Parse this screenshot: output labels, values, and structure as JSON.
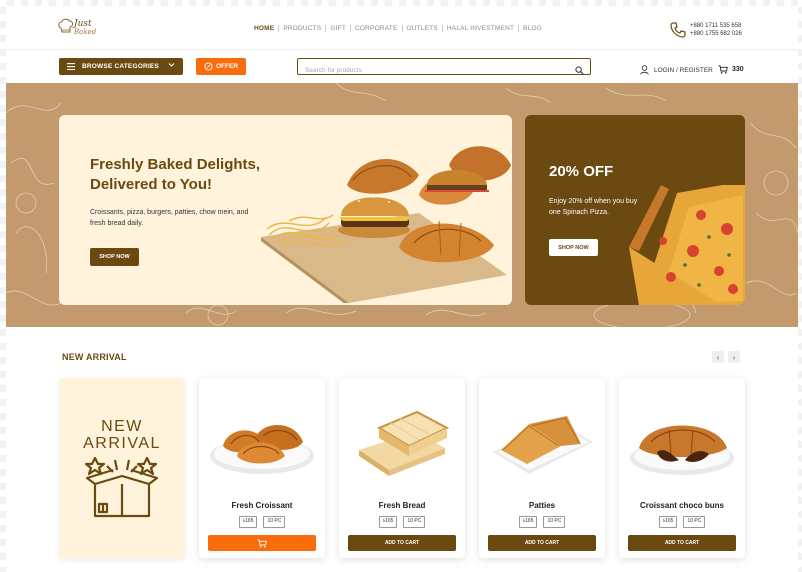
{
  "brand": {
    "logo_text_line1": "Just",
    "logo_text_line2": "Baked"
  },
  "nav": [
    {
      "label": "HOME",
      "active": true
    },
    {
      "label": "PRODUCTS"
    },
    {
      "label": "GIFT"
    },
    {
      "label": "CORPORATE"
    },
    {
      "label": "OUTLETS"
    },
    {
      "label": "HALAL INVESTMENT"
    },
    {
      "label": "BLOG"
    }
  ],
  "contact": {
    "phone1": "+880 1711 535 658",
    "phone2": "+880 1755 682 026"
  },
  "toolbar": {
    "browse_label": "BROWSE CATEGORIES",
    "offer_label": "OFFER",
    "search_placeholder": "Search for products",
    "login_label": "LOGIN / REGISTER",
    "cart_count": "330"
  },
  "hero": {
    "title": "Freshly Baked Delights, Delivered to You!",
    "description": "Croissants, pizza, burgers, patties, chow mein, and fresh bread daily.",
    "button_label": "SHOP NOW"
  },
  "promo": {
    "title": "20% OFF",
    "description": "Enjoy 20% off when you buy one Spinach Pizza.",
    "button_label": "SHOP NOW"
  },
  "new_arrival": {
    "section_title": "NEW ARRIVAL",
    "tile_line1": "NEW",
    "tile_line2": "ARRIVAL",
    "prev_icon": "chevron-left-icon",
    "next_icon": "chevron-right-icon",
    "products": [
      {
        "name": "Fresh Croissant",
        "price": "৳165",
        "qty": "10 PC",
        "cta": "",
        "cta_icon": "cart-icon"
      },
      {
        "name": "Fresh Bread",
        "price": "৳165",
        "qty": "10 PC",
        "cta": "ADD TO CART"
      },
      {
        "name": "Patties",
        "price": "৳165",
        "qty": "10 PC",
        "cta": "ADD TO CART"
      },
      {
        "name": "Croissant choco buns",
        "price": "৳165",
        "qty": "10 PC",
        "cta": "ADD TO CART"
      }
    ]
  },
  "colors": {
    "brand_brown": "#6b4a12",
    "accent_orange": "#f76c0c",
    "hero_bg": "#c29a6d",
    "cream": "#fff3dc"
  }
}
